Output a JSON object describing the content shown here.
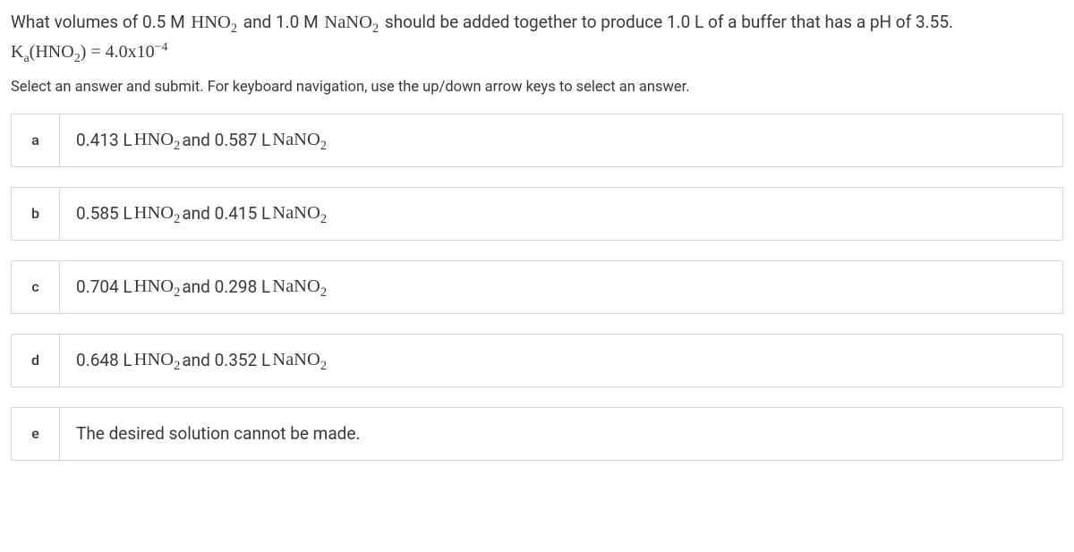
{
  "question": {
    "line1_pre": "What volumes of 0.5 M ",
    "chem1": "HNO",
    "line1_mid1": " and 1.0 M ",
    "chem2": "NaNO",
    "line1_post": " should be added together to produce 1.0 L of a buffer that has a pH of 3.55.",
    "ka_label_pre": "K",
    "ka_label_sub": "a",
    "ka_paren_open": "(",
    "ka_chem": "HNO",
    "ka_paren_close": ")",
    "ka_eq": " = 4.0x10",
    "ka_exp": "−4"
  },
  "instruction": "Select an answer and submit. For keyboard navigation, use the up/down arrow keys to select an answer.",
  "options": [
    {
      "letter": "a",
      "v1": "0.413 L ",
      "c1": "HNO",
      "mid": " and 0.587 L ",
      "c2": "NaNO",
      "plain": ""
    },
    {
      "letter": "b",
      "v1": "0.585 L ",
      "c1": "HNO",
      "mid": " and 0.415 L ",
      "c2": "NaNO",
      "plain": ""
    },
    {
      "letter": "c",
      "v1": "0.704 L ",
      "c1": "HNO",
      "mid": " and 0.298 L ",
      "c2": "NaNO",
      "plain": ""
    },
    {
      "letter": "d",
      "v1": "0.648 L ",
      "c1": "HNO",
      "mid": " and 0.352 L ",
      "c2": "NaNO",
      "plain": ""
    },
    {
      "letter": "e",
      "v1": "",
      "c1": "",
      "mid": "",
      "c2": "",
      "plain": "The desired solution cannot be made."
    }
  ]
}
